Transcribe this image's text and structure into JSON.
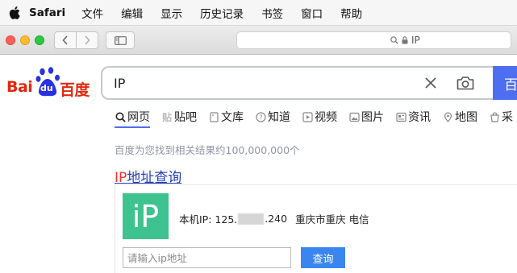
{
  "menubar": {
    "app_name": "Safari",
    "items": [
      "文件",
      "编辑",
      "显示",
      "历史记录",
      "书签",
      "窗口",
      "帮助"
    ]
  },
  "browser": {
    "address": "IP"
  },
  "baidu": {
    "logo_left": "Bai",
    "logo_paw": "du",
    "logo_right": "百度",
    "search_value": "IP",
    "search_button_label": "百",
    "tabs": [
      {
        "label": "网页",
        "icon": "search-icon"
      },
      {
        "label": "贴吧",
        "icon": "tieba-icon"
      },
      {
        "label": "文库",
        "icon": "doc-icon"
      },
      {
        "label": "知道",
        "icon": "question-icon"
      },
      {
        "label": "视频",
        "icon": "video-icon"
      },
      {
        "label": "图片",
        "icon": "image-icon"
      },
      {
        "label": "资讯",
        "icon": "news-icon"
      },
      {
        "label": "地图",
        "icon": "map-icon"
      },
      {
        "label": "采",
        "icon": "shop-icon"
      }
    ],
    "result_count": "百度为您找到相关结果约100,000,000个",
    "result": {
      "title_highlight": "IP",
      "title_rest": "地址查询",
      "logo_text": "iP",
      "ip_label": "本机IP: 125.",
      "ip_suffix": ".240",
      "location": "重庆市重庆 电信",
      "input_placeholder": "请输入ip地址",
      "button_label": "查询"
    }
  },
  "colors": {
    "baidu_blue": "#4e6ef2",
    "baidu_red": "#de2910",
    "ip_green": "#3ec28f",
    "query_blue": "#3a86f1"
  }
}
